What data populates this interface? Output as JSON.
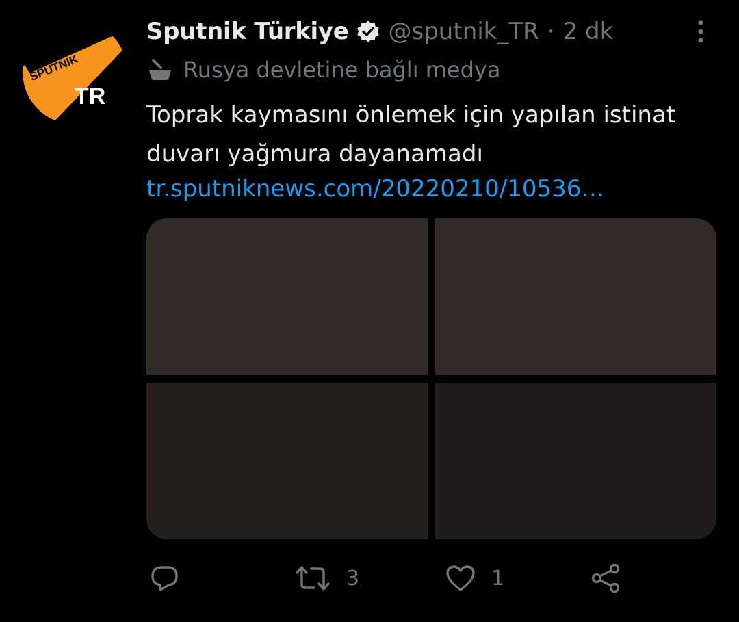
{
  "tweet": {
    "author_name": "Sputnik Türkiye",
    "author_handle": "@sputnik_TR",
    "separator": "·",
    "timestamp": "2 dk",
    "state_media_label": "Rusya devletine bağlı medya",
    "text": "Toprak kaymasını önlemek için yapılan istinat duvarı yağmura dayanamadı",
    "link": "tr.sputniknews.com/20220210/10536…",
    "avatar": {
      "banner_text": "SPUTNIK",
      "tr_text": "TR",
      "banner_color": "#f7941d"
    },
    "media_tiles": [
      {
        "color": "#342a27"
      },
      {
        "color": "#342a27"
      },
      {
        "color": "#251f1e"
      },
      {
        "color": "#211c1c"
      }
    ],
    "actions": {
      "reply_icon": "reply-icon",
      "retweet_icon": "retweet-icon",
      "retweet_count": "3",
      "like_icon": "heart-icon",
      "like_count": "1",
      "share_icon": "share-icon"
    }
  },
  "colors": {
    "background": "#000000",
    "primary_text": "#e7e9ea",
    "secondary_text": "#71767b",
    "link": "#1d9bf0"
  }
}
